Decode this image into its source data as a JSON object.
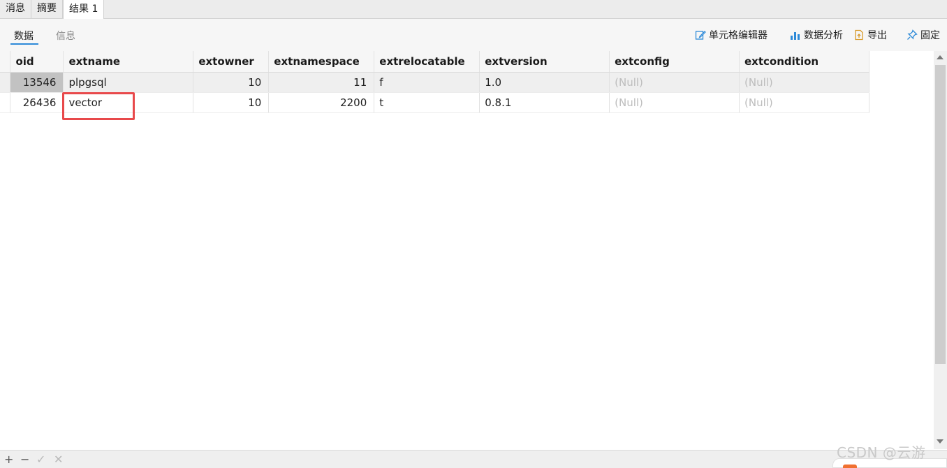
{
  "result_tabs": [
    "消息",
    "摘要",
    "结果 1"
  ],
  "sub_tabs": {
    "data": "数据",
    "info": "信息"
  },
  "toolbar": {
    "cell_editor": "单元格编辑器",
    "data_analysis": "数据分析",
    "export": "导出",
    "pin": "固定"
  },
  "grid": {
    "columns": [
      "oid",
      "extname",
      "extowner",
      "extnamespace",
      "extrelocatable",
      "extversion",
      "extconfig",
      "extcondition"
    ],
    "rows": [
      [
        "13546",
        "plpgsql",
        "10",
        "11",
        "f",
        "1.0",
        "(Null)",
        "(Null)"
      ],
      [
        "26436",
        "vector",
        "10",
        "2200",
        "t",
        "0.8.1",
        "(Null)",
        "(Null)"
      ]
    ]
  },
  "bottom": {
    "add": "+",
    "remove": "−",
    "apply": "✓",
    "discard": "✕"
  },
  "watermark": "CSDN @云游",
  "colors": {
    "accent": "#2d8ad8",
    "highlight": "#e8494b",
    "null_text": "#bdbdbd"
  }
}
